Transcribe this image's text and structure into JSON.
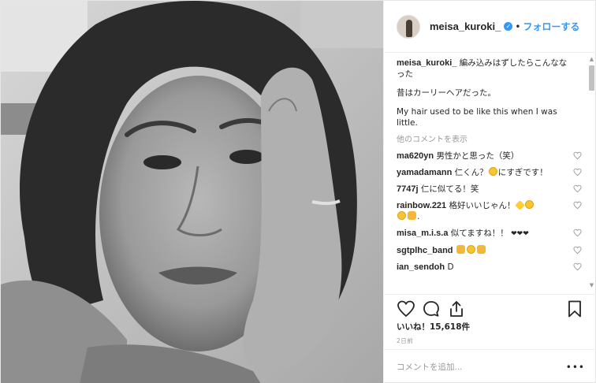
{
  "post": {
    "username": "meisa_kuroki_",
    "verified_mark": "✓",
    "dot": "•",
    "follow_label": "フォローする",
    "caption_line1": "編み込みはずしたらこんなな",
    "caption_line2": "った",
    "caption_para2": "昔はカーリーヘアだった。",
    "caption_para3": "My hair used to be like this when I was little.",
    "more_comments": "他のコメントを表示",
    "likes": "いいね！15,618件",
    "time": "2日前",
    "comment_placeholder": "コメントを追加...",
    "more_menu": "•••"
  },
  "comments": [
    {
      "user": "ma620yn",
      "text": "男性かと思った（笑）"
    },
    {
      "user": "yamadamann",
      "text_a": "仁くん？",
      "text_b": "にすぎです！"
    },
    {
      "user": "7747j",
      "text": "仁に似てる！笑"
    },
    {
      "user": "rainbow.221",
      "text": "格好いいじゃん！"
    },
    {
      "user": "misa_m.i.s.a",
      "text": "似てますね！！",
      "hearts": "❤❤❤"
    },
    {
      "user": "sgtplhc_band",
      "text": ""
    },
    {
      "user": "ian_sendoh",
      "text": "D"
    }
  ],
  "icons": [
    "photo-image",
    "avatar-image",
    "verified-badge-icon",
    "heart-icon",
    "comment-icon",
    "share-icon",
    "bookmark-icon",
    "scroll-up-arrow-icon",
    "scroll-down-arrow-icon"
  ],
  "colors": {
    "link_blue": "#3897f0",
    "meta_gray": "#999999",
    "border": "#efefef"
  }
}
